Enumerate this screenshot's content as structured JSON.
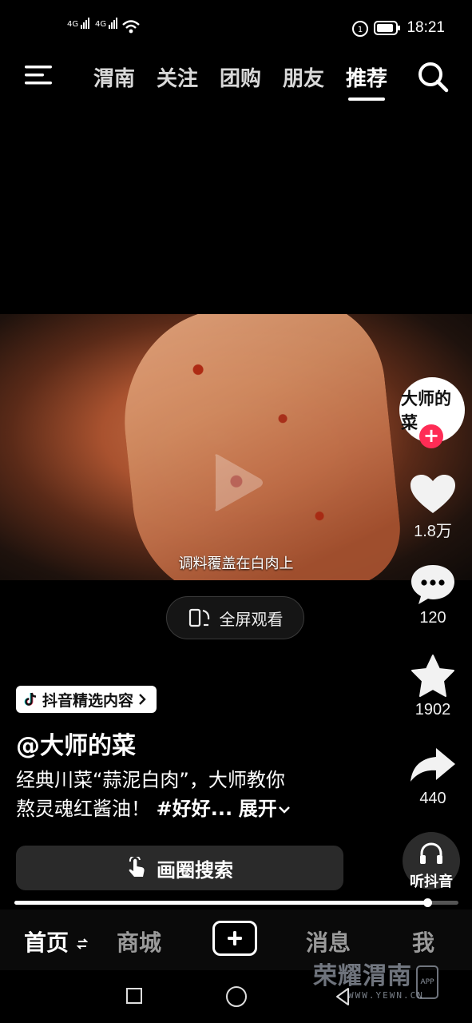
{
  "status": {
    "sim1": "4G",
    "sim2": "4G",
    "time": "18:21"
  },
  "top_nav": {
    "tabs": [
      "渭南",
      "关注",
      "团购",
      "朋友",
      "推荐"
    ],
    "active_tab": "推荐"
  },
  "video": {
    "subtitle": "调料覆盖在白肉上",
    "fullscreen_label": "全屏观看"
  },
  "creator": {
    "avatar_text": "大师的菜",
    "handle": "@大师的菜"
  },
  "actions": {
    "likes": "1.8万",
    "comments": "120",
    "favorites": "1902",
    "shares": "440",
    "listen_label": "听抖音"
  },
  "post": {
    "badge": "抖音精选内容",
    "description_line1": "经典川菜“蒜泥白肉”，大师教你",
    "description_line2": "熬灵魂红酱油！",
    "hashtag": "#好好...",
    "expand_label": "展开",
    "search_label": "画圈搜索",
    "progress_fraction": 0.93
  },
  "bottom_nav": {
    "home": "首页",
    "mall": "商城",
    "messages": "消息",
    "me": "我"
  },
  "watermark": {
    "brand": "荣耀渭南",
    "site": "WWW.YEWN.CN",
    "app": "APP"
  }
}
